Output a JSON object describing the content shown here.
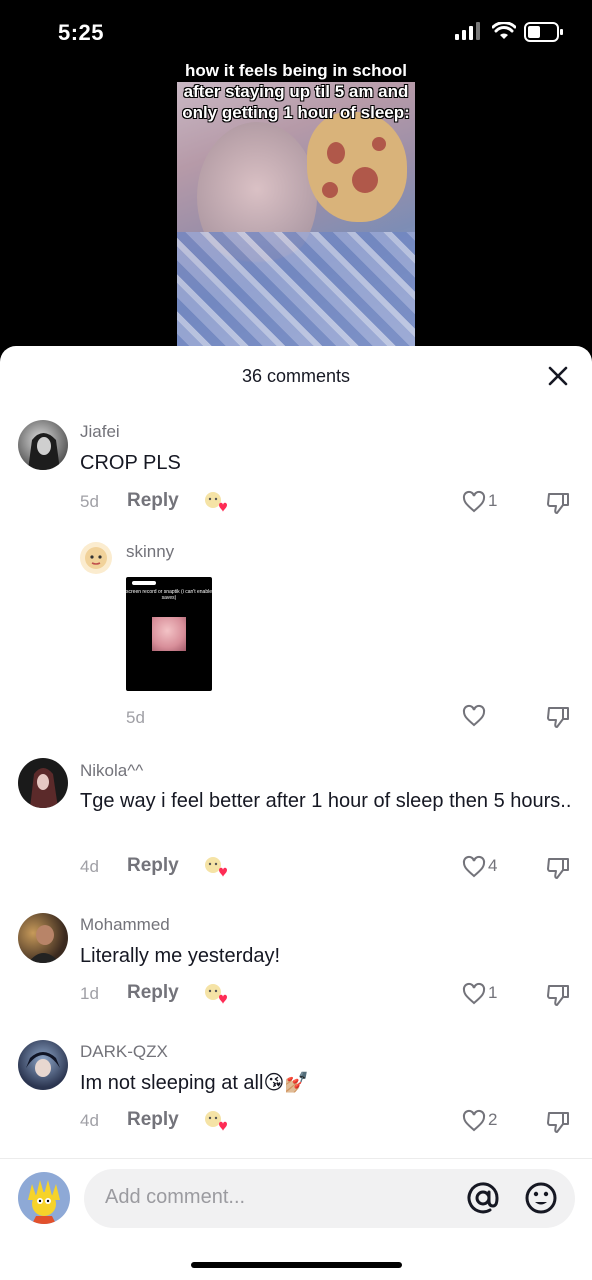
{
  "status_bar": {
    "time": "5:25"
  },
  "video": {
    "caption": "how it feels being in school after staying up til 5 am and only getting 1 hour of sleep:"
  },
  "sheet": {
    "title": "36 comments"
  },
  "comments": [
    {
      "username": "Jiafei",
      "text": "CROP PLS",
      "date": "5d",
      "reply_label": "Reply",
      "likes": "1"
    },
    {
      "username": "Nikola^^",
      "text": "Tge way i feel better after 1 hour of sleep then 5 hours..",
      "date": "4d",
      "reply_label": "Reply",
      "likes": "4"
    },
    {
      "username": "Mohammed",
      "text": "Literally me yesterday!",
      "date": "1d",
      "reply_label": "Reply",
      "likes": "1"
    },
    {
      "username": "DARK-QZX",
      "text": "Im not sleeping at all😘💅🏼",
      "date": "4d",
      "reply_label": "Reply",
      "likes": "2"
    }
  ],
  "reply": {
    "username": "skinny",
    "date": "5d",
    "thumb_text": "screen record or snaptik (i can't enable saves)"
  },
  "composer": {
    "placeholder": "Add comment..."
  },
  "colors": {
    "accent_heart": "#fe2c55",
    "text_primary": "#161823",
    "text_secondary": "#73737a"
  }
}
